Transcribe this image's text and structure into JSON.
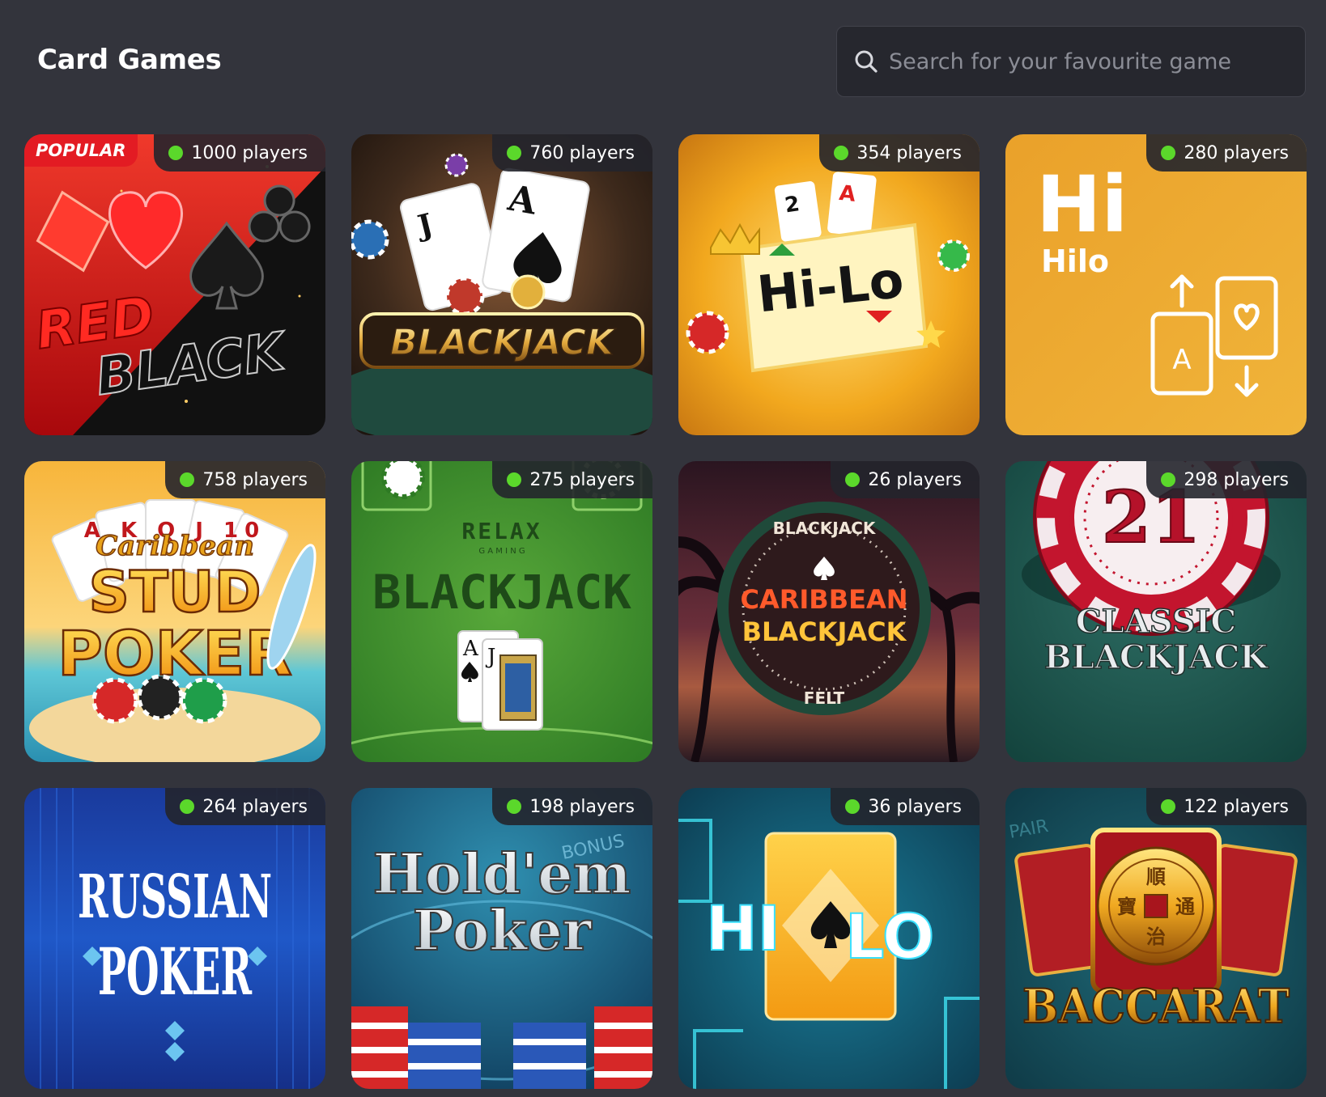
{
  "header": {
    "title": "Card Games",
    "search_placeholder": "Search for your favourite game"
  },
  "games": [
    {
      "name": "RED BLACK",
      "line1": "RED",
      "line2": "BLACK",
      "players": "1000 players",
      "tag": "POPULAR"
    },
    {
      "name": "BLACKJACK",
      "card1": "J",
      "card2": "A",
      "players": "760 players"
    },
    {
      "name": "Hi-Lo",
      "card1": "2",
      "card2": "A",
      "players": "354 players"
    },
    {
      "name": "Hilo",
      "big": "Hi",
      "small": "Hilo",
      "card": "A",
      "players": "280 players"
    },
    {
      "name": "Caribbean STUD POKER",
      "cards": "A K Q J 10",
      "line1": "Caribbean",
      "line2": "STUD",
      "line3": "POKER",
      "players": "758 players"
    },
    {
      "name": "BLACKJACK",
      "brand": "RELAX",
      "brand_sub": "G A M I N G",
      "card1": "A",
      "card2": "J",
      "players": "275 players"
    },
    {
      "name": "CARIBBEAN BLACKJACK",
      "top": "BLACKJACK",
      "line1": "CARIBBEAN",
      "line2": "BLACKJACK",
      "bottom": "FELT",
      "players": "26 players"
    },
    {
      "name": "CLASSIC BLACKJACK",
      "chip": "21",
      "line1": "CLASSIC",
      "line2": "BLACKJACK",
      "players": "298 players"
    },
    {
      "name": "RUSSIAN POKER",
      "line1": "RUSSIAN",
      "line2": "POKER",
      "players": "264 players"
    },
    {
      "name": "Hold'em Poker",
      "line1": "Hold'em",
      "line2": "Poker",
      "bonus": "BONUS",
      "players": "198 players"
    },
    {
      "name": "HI LO",
      "left": "HI",
      "right": "LO",
      "players": "36 players"
    },
    {
      "name": "BACCARAT",
      "coin_chars": [
        "順",
        "寶",
        "通",
        "治"
      ],
      "pair": "PAIR",
      "title": "BACCARAT",
      "players": "122 players"
    }
  ],
  "colors": {
    "background": "#33343c",
    "search_bg": "#26272e",
    "online_dot": "#5bd82b",
    "popular_badge": "#e31b23"
  }
}
